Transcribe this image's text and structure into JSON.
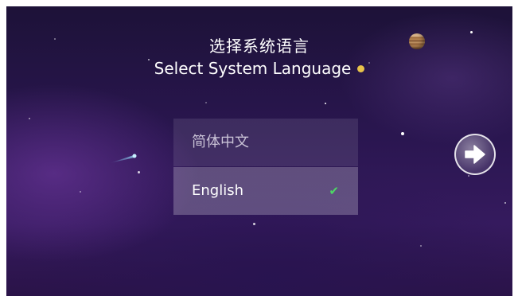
{
  "header": {
    "title_cn": "选择系统语言",
    "title_en": "Select System Language"
  },
  "languages": [
    {
      "label": "简体中文",
      "selected": false
    },
    {
      "label": "English",
      "selected": true
    }
  ],
  "selected_mark": "✔",
  "colors": {
    "background": "#2a1650",
    "check": "#4cd964",
    "accent_dot": "#e8c34a"
  },
  "icons": {
    "next": "arrow-right-icon",
    "check": "check-icon"
  }
}
